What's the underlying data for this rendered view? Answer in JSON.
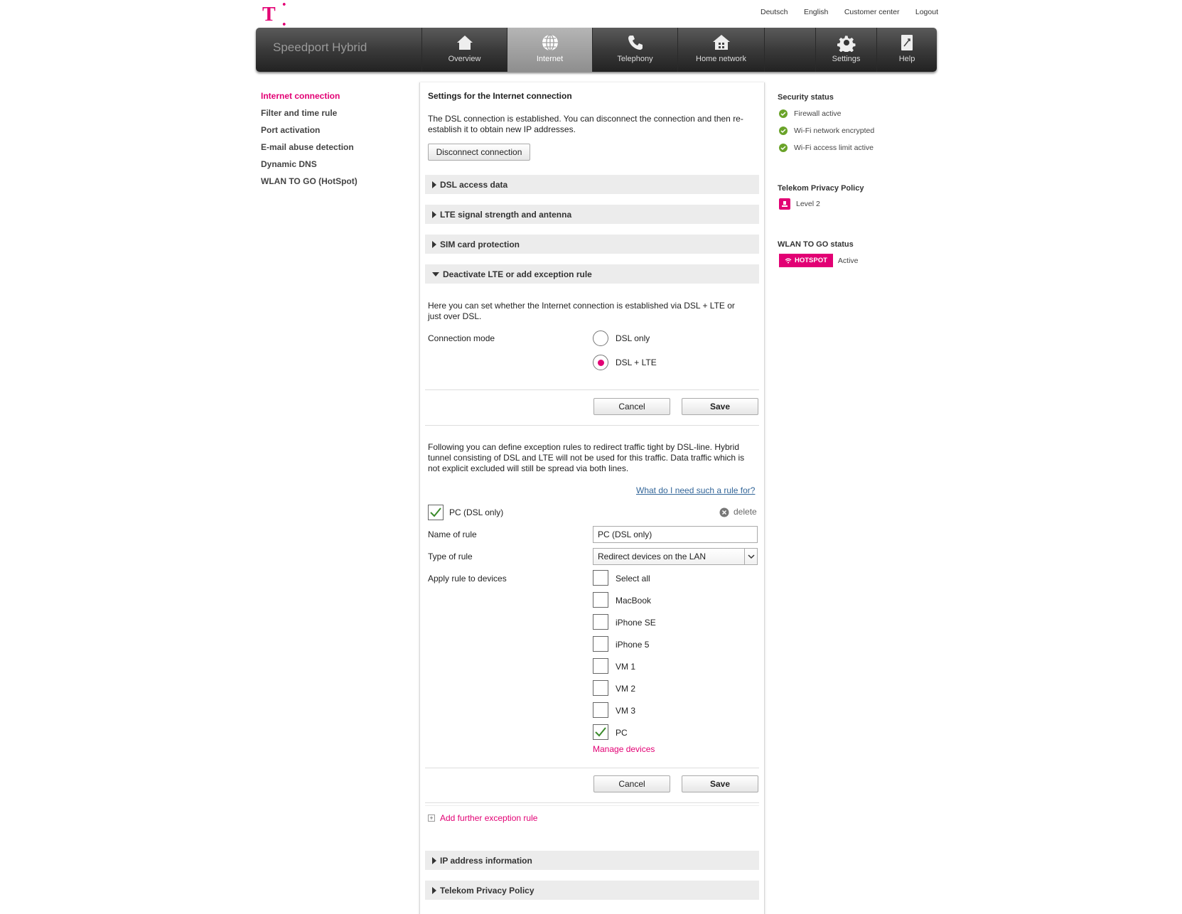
{
  "header": {
    "logo_text": "T",
    "logo_dots": "· ·",
    "links": [
      "Deutsch",
      "English",
      "Customer center",
      "Logout"
    ]
  },
  "navbar": {
    "brand": "Speedport Hybrid",
    "items": [
      {
        "label": "Overview",
        "icon": "house-icon"
      },
      {
        "label": "Internet",
        "icon": "globe-icon"
      },
      {
        "label": "Telephony",
        "icon": "phone-icon"
      },
      {
        "label": "Home network",
        "icon": "home-network-icon"
      },
      {
        "label": "Settings",
        "icon": "gear-icon"
      },
      {
        "label": "Help",
        "icon": "help-book-icon"
      }
    ]
  },
  "sidebar": {
    "items": [
      {
        "label": "Internet connection"
      },
      {
        "label": "Filter and time rule"
      },
      {
        "label": "Port activation"
      },
      {
        "label": "E-mail abuse detection"
      },
      {
        "label": "Dynamic DNS"
      },
      {
        "label": "WLAN TO GO (HotSpot)"
      }
    ]
  },
  "main": {
    "title": "Settings for the Internet connection",
    "intro_line1": "The DSL connection is established. You can disconnect the connection and then re-",
    "intro_line2": "establish it to obtain new IP addresses.",
    "disconnect_button": "Disconnect connection",
    "sections": {
      "dsl_access": "DSL access data",
      "lte_signal": "LTE signal strength and antenna",
      "sim": "SIM card protection",
      "deactivate_lte": "Deactivate LTE or add exception rule",
      "ip_info": "IP address information",
      "privacy": "Telekom Privacy Policy"
    },
    "mode_desc_line1": "Here you can set whether the Internet connection is established via DSL + LTE or",
    "mode_desc_line2": "just over DSL.",
    "connection_mode_label": "Connection mode",
    "mode_options": [
      {
        "label": "DSL only",
        "selected": false
      },
      {
        "label": "DSL + LTE",
        "selected": true
      }
    ],
    "cancel_label": "Cancel",
    "save_label": "Save",
    "exception_desc_line1": "Following you can define exception rules to redirect traffic tight by DSL-line. Hybrid",
    "exception_desc_line2": "tunnel consisting of DSL and LTE will not be used for this traffic. Data traffic which is",
    "exception_desc_line3": "not explicit excluded will still be spread via both lines.",
    "help_link": "What do I need such a rule for?",
    "rule": {
      "enabled": true,
      "title": "PC (DSL only)",
      "delete_label": "delete",
      "name_label": "Name of rule",
      "name_value": "PC (DSL only)",
      "type_label": "Type of rule",
      "type_value": "Redirect devices on the LAN",
      "devices_label": "Apply rule to devices",
      "devices": [
        {
          "label": "Select all",
          "checked": false
        },
        {
          "label": "MacBook",
          "checked": false
        },
        {
          "label": "iPhone SE",
          "checked": false
        },
        {
          "label": "iPhone 5",
          "checked": false
        },
        {
          "label": "VM 1",
          "checked": false
        },
        {
          "label": "VM 2",
          "checked": false
        },
        {
          "label": "VM 3",
          "checked": false
        },
        {
          "label": "PC",
          "checked": true
        }
      ],
      "manage_devices": "Manage devices"
    },
    "add_rule": "Add further exception rule"
  },
  "status": {
    "security_title": "Security status",
    "security_items": [
      "Firewall active",
      "Wi-Fi network encrypted",
      "Wi-Fi access limit active"
    ],
    "privacy_title": "Telekom Privacy Policy",
    "privacy_level": "Level 2",
    "wlan_title": "WLAN TO GO status",
    "hotspot_badge": "HOTSPOT",
    "wlan_status": "Active"
  },
  "colors": {
    "accent": "#e20074",
    "ok": "#6aa329"
  }
}
